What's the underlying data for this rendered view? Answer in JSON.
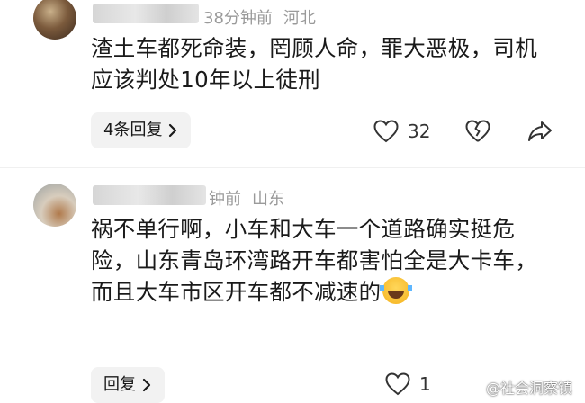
{
  "comments": [
    {
      "time": "38分钟前",
      "location": "河北",
      "text": "渣土车都死命装，罔顾人命，罪大恶极，司机应该判处10年以上徒刑",
      "reply_label": "4条回复",
      "likes": "32"
    },
    {
      "time": "钟前",
      "location": "山东",
      "text": "祸不单行啊，小车和大车一个道路确实挺危险，山东青岛环湾路开车都害怕全是大卡车，而且大车市区开车都不减速的",
      "reply_label": "回复",
      "likes": "1"
    }
  ],
  "watermark": "@社会洞察镇",
  "colors": {
    "meta_gray": "#9a9a9a",
    "reply_bg": "#f2f2f2",
    "text": "#1a1a1a"
  },
  "icons": [
    "heart-icon",
    "broken-heart-icon",
    "share-icon",
    "chevron-right-icon",
    "laugh-cry-emoji"
  ]
}
